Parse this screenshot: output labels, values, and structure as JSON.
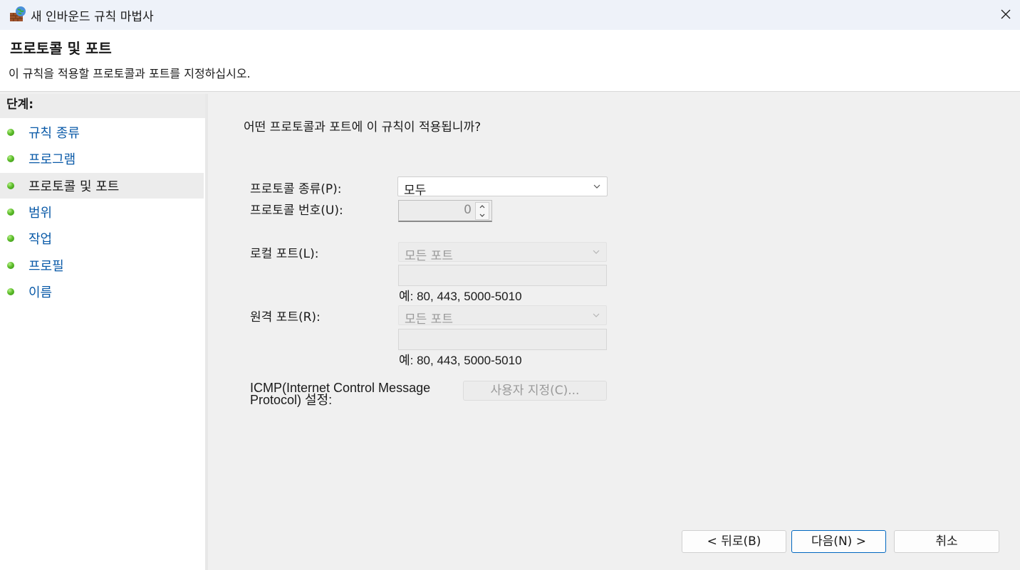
{
  "window": {
    "title": "새 인바운드 규칙 마법사",
    "icon": "firewall-globe-icon"
  },
  "header": {
    "title": "프로토콜 및 포트",
    "subtitle": "이 규칙을 적용할 프로토콜과 포트를 지정하십시오."
  },
  "steps": {
    "heading": "단계:",
    "items": [
      {
        "label": "규칙 종류",
        "active": false
      },
      {
        "label": "프로그램",
        "active": false
      },
      {
        "label": "프로토콜 및 포트",
        "active": true
      },
      {
        "label": "범위",
        "active": false
      },
      {
        "label": "작업",
        "active": false
      },
      {
        "label": "프로필",
        "active": false
      },
      {
        "label": "이름",
        "active": false
      }
    ]
  },
  "main": {
    "question": "어떤 프로토콜과 포트에 이 규칙이 적용됩니까?",
    "protocol_type": {
      "label": "프로토콜 종류(P):",
      "value": "모두"
    },
    "protocol_number": {
      "label": "프로토콜 번호(U):",
      "value": "0"
    },
    "local_port": {
      "label": "로컬 포트(L):",
      "value": "모든 포트",
      "text": "",
      "hint": "예: 80, 443, 5000-5010"
    },
    "remote_port": {
      "label": "원격 포트(R):",
      "value": "모든 포트",
      "text": "",
      "hint": "예: 80, 443, 5000-5010"
    },
    "icmp": {
      "label_line1": "ICMP(Internet Control Message",
      "label_line2": "Protocol) 설정:",
      "button": "사용자 지정(C)..."
    }
  },
  "footer": {
    "back": "< 뒤로(B)",
    "next": "다음(N) >",
    "cancel": "취소"
  },
  "colors": {
    "link": "#0a5aa8",
    "primary_border": "#0067c0",
    "step_dot": "#5fbe2b"
  }
}
